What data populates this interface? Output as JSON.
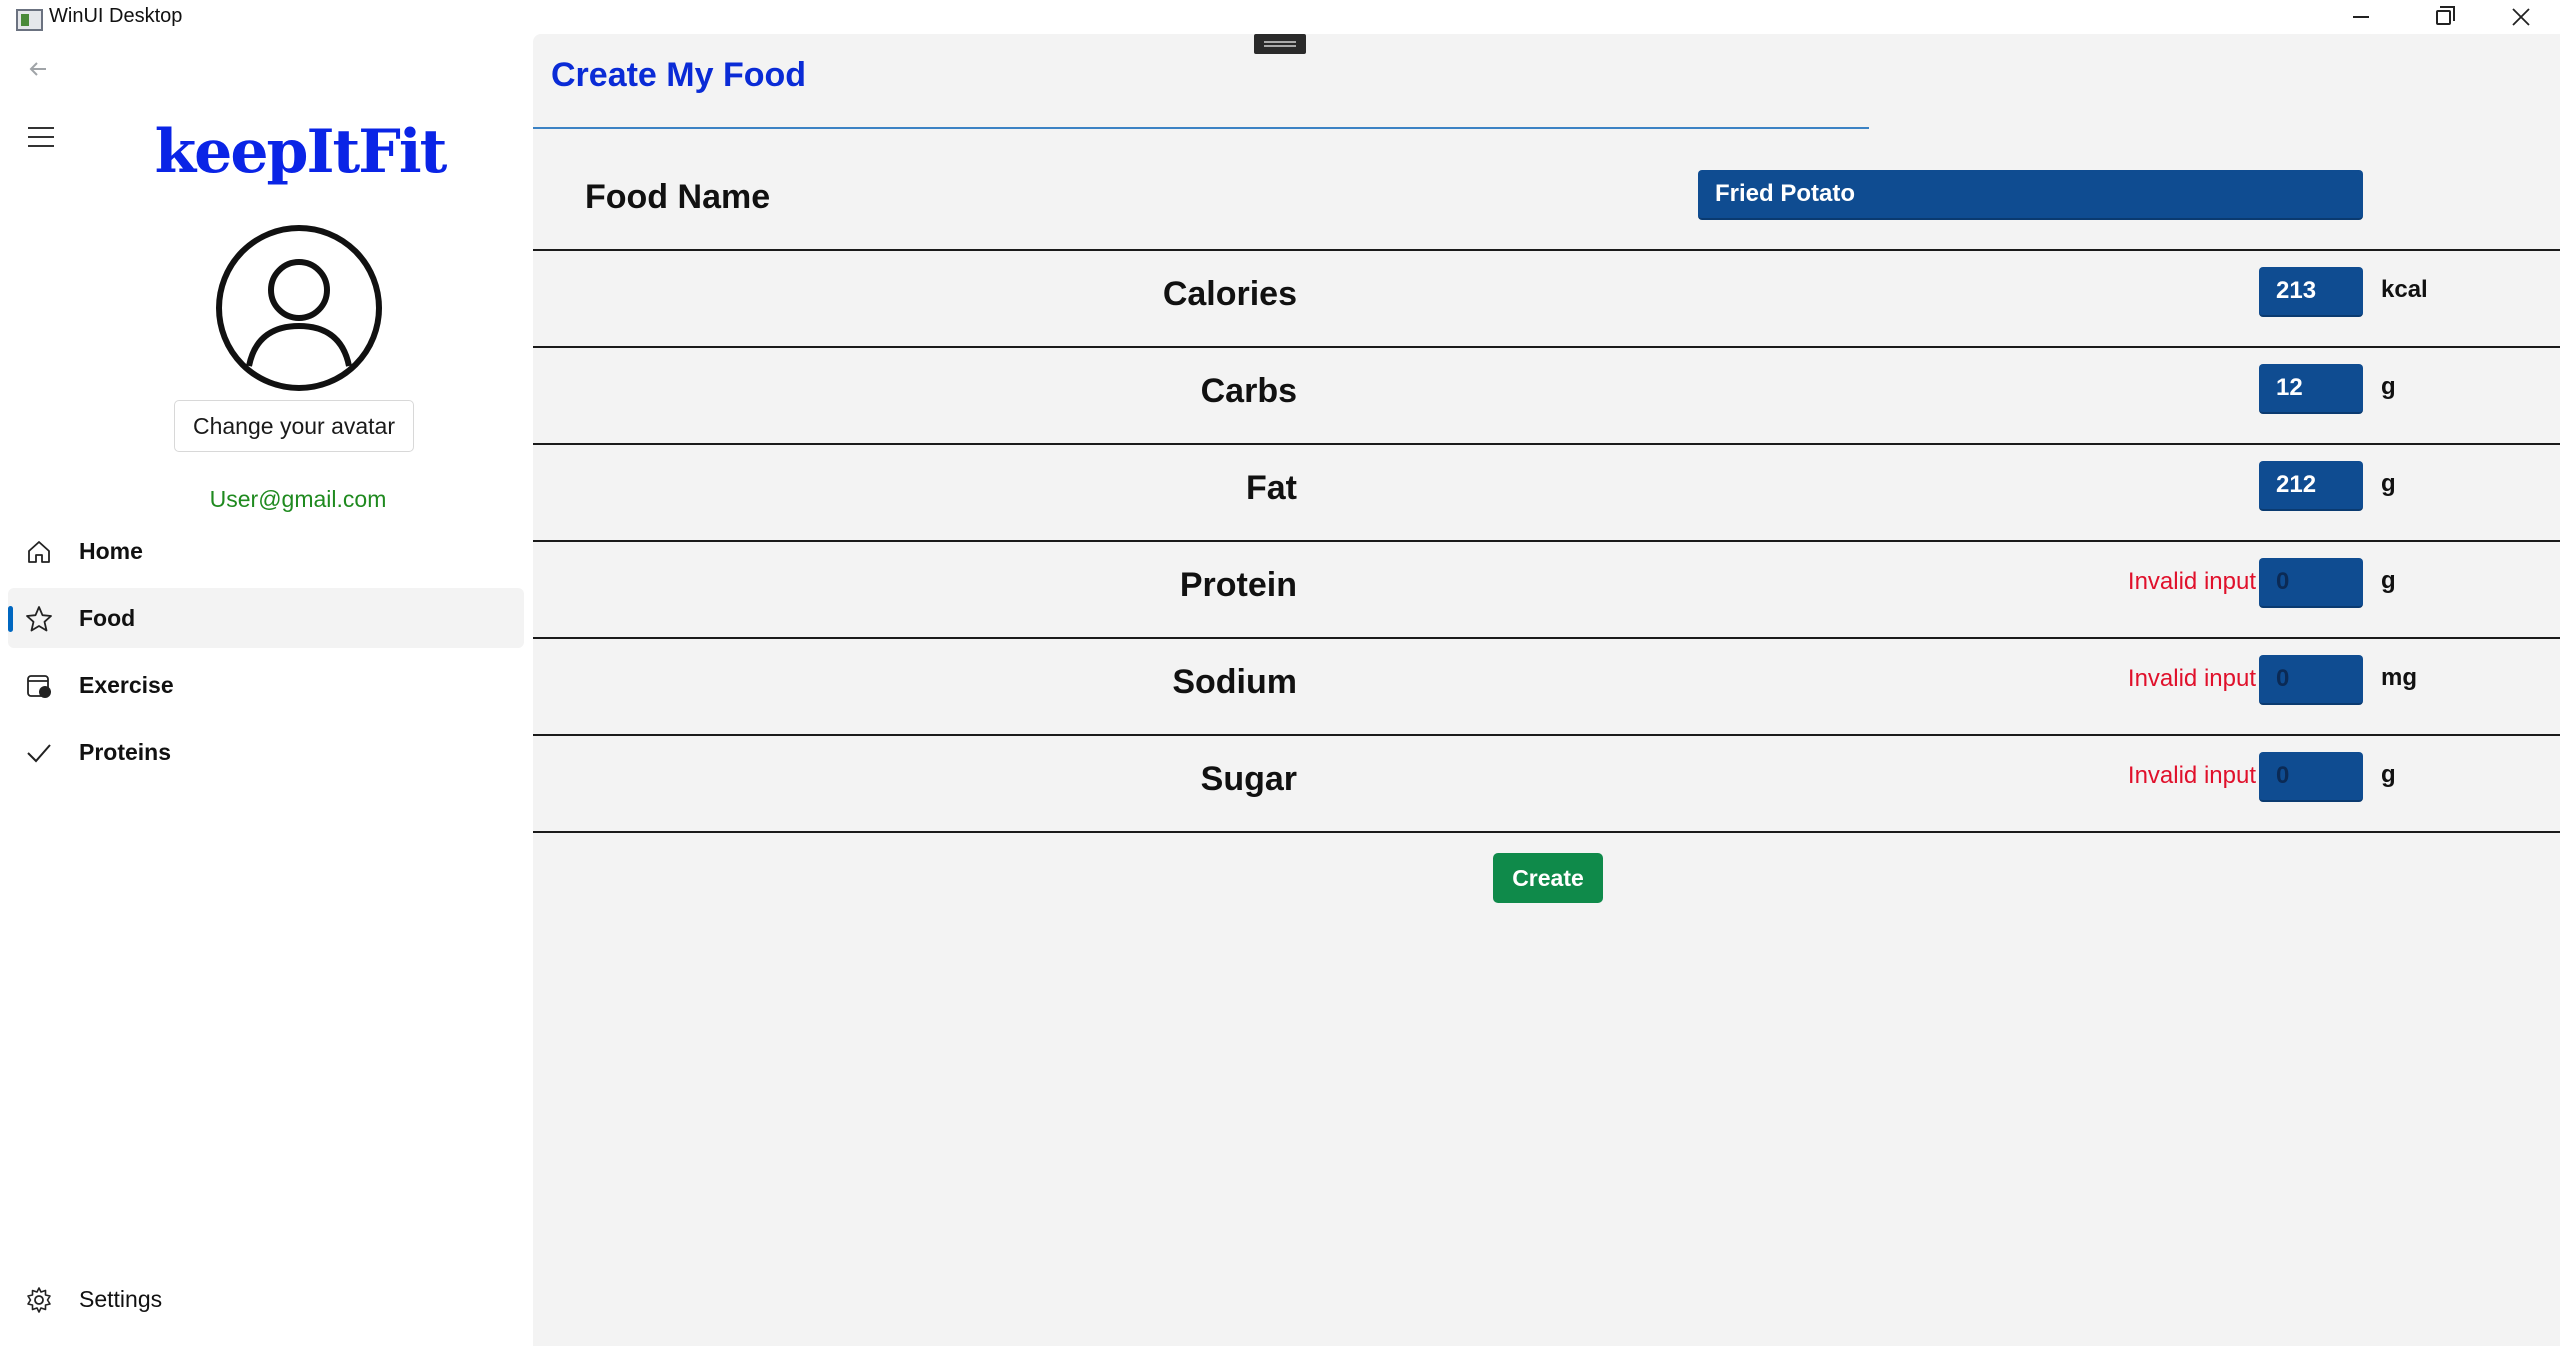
{
  "window": {
    "title": "WinUI Desktop"
  },
  "sidebar": {
    "logo": "keepItFit",
    "change_avatar_label": "Change your avatar",
    "email": "User@gmail.com",
    "items": [
      {
        "label": "Home",
        "icon": "home-icon"
      },
      {
        "label": "Food",
        "icon": "star-icon",
        "selected": true
      },
      {
        "label": "Exercise",
        "icon": "calendar-icon"
      },
      {
        "label": "Proteins",
        "icon": "checkmark-icon"
      }
    ],
    "settings_label": "Settings"
  },
  "main": {
    "title": "Create My Food",
    "food_name_label": "Food Name",
    "food_name_value": "Fried Potato",
    "fields": [
      {
        "label": "Calories",
        "value": "213",
        "unit": "kcal",
        "error": ""
      },
      {
        "label": "Carbs",
        "value": "12",
        "unit": "g",
        "error": ""
      },
      {
        "label": "Fat",
        "value": "212",
        "unit": "g",
        "error": ""
      },
      {
        "label": "Protein",
        "value": "0",
        "unit": "g",
        "error": "Invalid input"
      },
      {
        "label": "Sodium",
        "value": "0",
        "unit": "mg",
        "error": "Invalid input"
      },
      {
        "label": "Sugar",
        "value": "0",
        "unit": "g",
        "error": "Invalid input"
      }
    ],
    "create_label": "Create"
  },
  "colors": {
    "accent_title": "#0a2bd6",
    "logo": "#0a24e6",
    "input_bg": "#0f4c91",
    "error": "#e0102b",
    "create_button": "#0f8a4a",
    "email": "#1f8a1f"
  }
}
